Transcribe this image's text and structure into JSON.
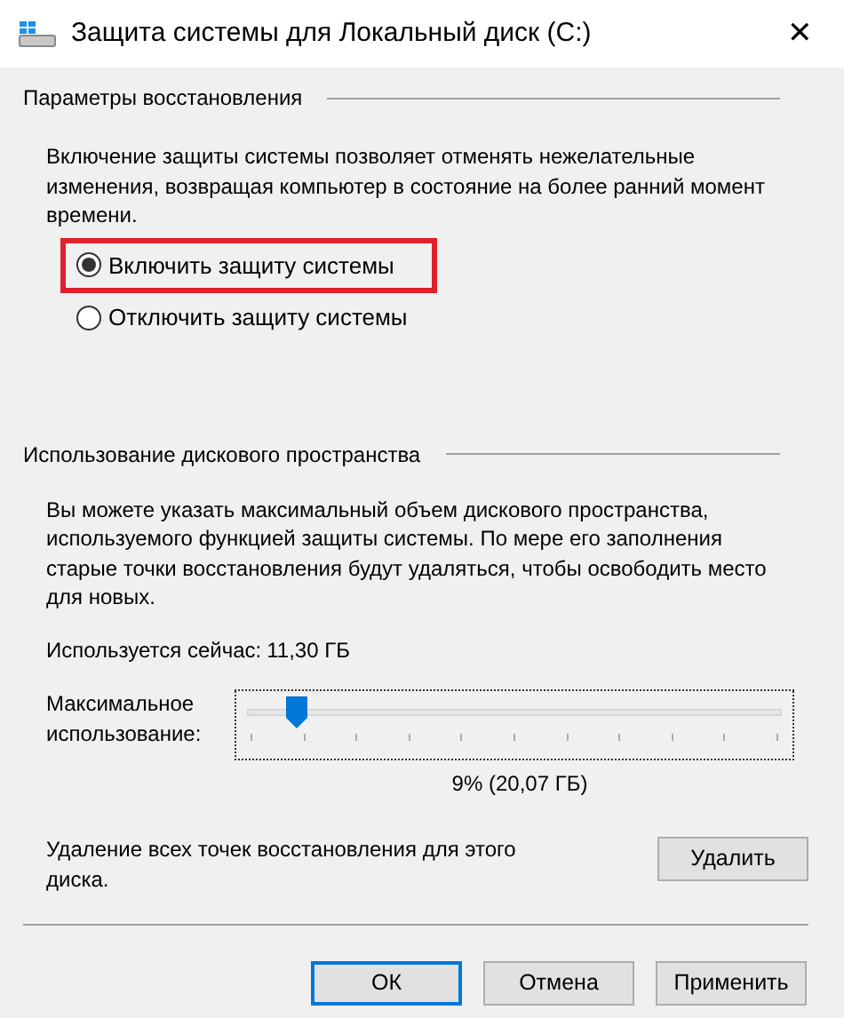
{
  "window": {
    "title": "Защита системы для Локальный диск (C:)",
    "close": "✕"
  },
  "restore_settings": {
    "heading": "Параметры восстановления",
    "description": "Включение защиты системы позволяет отменять нежелательные изменения, возвращая компьютер в состояние на более ранний момент времени.",
    "options": [
      {
        "label": "Включить защиту системы",
        "selected": true,
        "highlighted": true
      },
      {
        "label": "Отключить защиту системы",
        "selected": false,
        "highlighted": false
      }
    ]
  },
  "disk_usage": {
    "heading": "Использование дискового пространства",
    "description": "Вы можете указать максимальный объем дискового пространства, используемого функцией защиты системы. По мере его заполнения старые точки восстановления будут удаляться, чтобы освободить место для новых.",
    "current_label": "Используется сейчас:",
    "current_value": "11,30 ГБ",
    "slider": {
      "label": "Максимальное использование:",
      "level": 0.09,
      "reading": "9% (20,07 ГБ)"
    },
    "delete_text": "Удаление всех точек восстановления для этого диска.",
    "delete_button": "Удалить"
  },
  "buttons": [
    {
      "label": "ОК",
      "default": true
    },
    {
      "label": "Отмена",
      "default": false
    },
    {
      "label": "Применить",
      "default": false
    }
  ]
}
